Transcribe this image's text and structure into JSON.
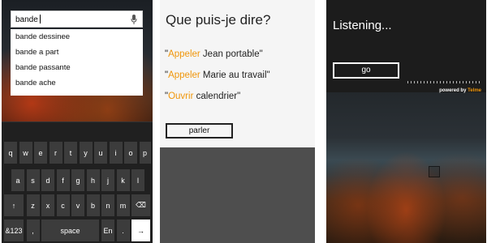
{
  "panel1": {
    "search": {
      "value": "bande"
    },
    "suggestions": [
      "bande dessinee",
      "bande a part",
      "bande passante",
      "bande ache"
    ],
    "keyboard": {
      "row1": [
        "q",
        "w",
        "e",
        "r",
        "t",
        "y",
        "u",
        "i",
        "o",
        "p"
      ],
      "row2": [
        "a",
        "s",
        "d",
        "f",
        "g",
        "h",
        "j",
        "k",
        "l"
      ],
      "row3": [
        "↑",
        "z",
        "x",
        "c",
        "v",
        "b",
        "n",
        "m",
        "⌫"
      ],
      "row4": {
        "symbols": "&123",
        "comma": ",",
        "space": "space",
        "lang": "En",
        "period": ".",
        "enter": "→"
      }
    }
  },
  "panel2": {
    "title": "Que puis-je dire?",
    "commands": [
      {
        "open_quote": "\"",
        "verb": "Appeler",
        "rest": " Jean portable\""
      },
      {
        "open_quote": "\"",
        "verb": "Appeler",
        "rest": " Marie au travail\""
      },
      {
        "open_quote": "\"",
        "verb": "Ouvrir",
        "rest": " calendrier\""
      }
    ],
    "button": "parler",
    "accent_color": "#f0960a"
  },
  "panel3": {
    "title": "Listening...",
    "button": "go",
    "powered_by": "powered by",
    "brand": "Telme",
    "accent_color": "#f0960a"
  }
}
